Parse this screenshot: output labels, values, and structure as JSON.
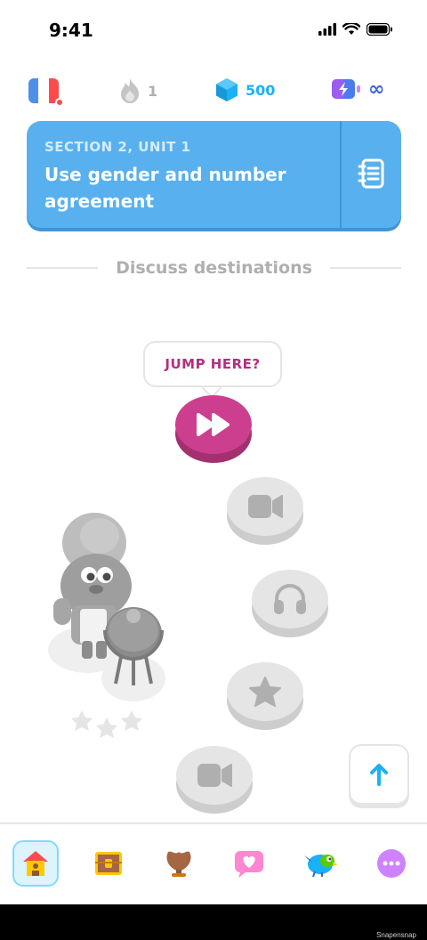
{
  "status_bar": {
    "time": "9:41"
  },
  "stats": {
    "streak": "1",
    "gems": "500",
    "energy": "∞"
  },
  "colors": {
    "banner": "#58b0ee",
    "pink_node": "#cc3f8f",
    "gray_node": "#e5e5e5",
    "gem_text": "#1cb0f6",
    "energy_text": "#3b62e0"
  },
  "banner": {
    "section": "SECTION 2, UNIT 1",
    "title": "Use gender and number agreement"
  },
  "section_divider": "Discuss destinations",
  "tooltip": "JUMP HERE?",
  "nodes": [
    {
      "icon": "fast-forward-icon",
      "state": "active"
    },
    {
      "icon": "video-camera-icon",
      "state": "locked"
    },
    {
      "icon": "headphones-icon",
      "state": "locked"
    },
    {
      "icon": "star-icon",
      "state": "locked"
    },
    {
      "icon": "video-camera-icon",
      "state": "locked"
    }
  ],
  "bottom_nav": [
    {
      "icon": "home-icon",
      "active": true
    },
    {
      "icon": "treasure-chest-icon",
      "active": false
    },
    {
      "icon": "trophy-shield-icon",
      "active": false
    },
    {
      "icon": "heart-chat-icon",
      "active": false
    },
    {
      "icon": "bird-icon",
      "active": false
    },
    {
      "icon": "more-icon",
      "active": false
    }
  ],
  "watermark": "Snapensnap"
}
